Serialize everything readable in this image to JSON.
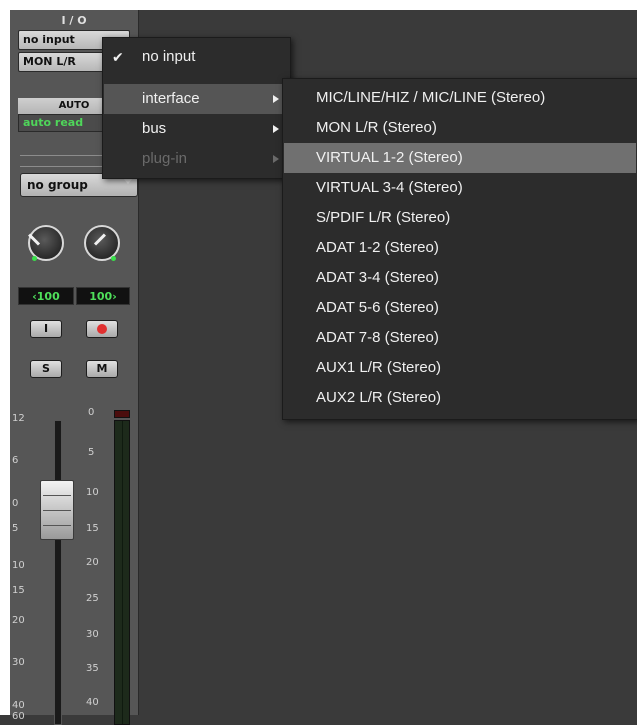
{
  "channel": {
    "io_label": "I / O",
    "input_button": "no input",
    "output_button": "MON L/R",
    "automation_label": "AUTO",
    "automation_mode": "auto read",
    "group_button": "no group",
    "pan_left": "‹100",
    "pan_right": "100›",
    "input_monitor_label": "I",
    "solo_label": "S",
    "mute_label": "M",
    "fader_scale": [
      "12",
      "6",
      "0",
      "5",
      "10",
      "15",
      "20",
      "30",
      "40",
      "60"
    ],
    "meter_scale": [
      "0",
      "5",
      "10",
      "15",
      "20",
      "25",
      "30",
      "35",
      "40"
    ],
    "fader_level_db": 0,
    "accent_color": "#4fd65a"
  },
  "input_menu": {
    "items": [
      {
        "label": "no input",
        "checked": true,
        "has_submenu": false,
        "disabled": false
      },
      {
        "label": "interface",
        "checked": false,
        "has_submenu": true,
        "disabled": false
      },
      {
        "label": "bus",
        "checked": false,
        "has_submenu": true,
        "disabled": false
      },
      {
        "label": "plug-in",
        "checked": false,
        "has_submenu": true,
        "disabled": true
      }
    ],
    "check_glyph": "✔"
  },
  "interface_submenu": {
    "items": [
      "MIC/LINE/HIZ / MIC/LINE (Stereo)",
      "MON L/R (Stereo)",
      "VIRTUAL 1-2 (Stereo)",
      "VIRTUAL 3-4 (Stereo)",
      "S/PDIF L/R (Stereo)",
      "ADAT 1-2 (Stereo)",
      "ADAT 3-4 (Stereo)",
      "ADAT 5-6 (Stereo)",
      "ADAT 7-8 (Stereo)",
      "AUX1 L/R (Stereo)",
      "AUX2 L/R (Stereo)"
    ],
    "highlighted": "VIRTUAL 1-2 (Stereo)"
  }
}
